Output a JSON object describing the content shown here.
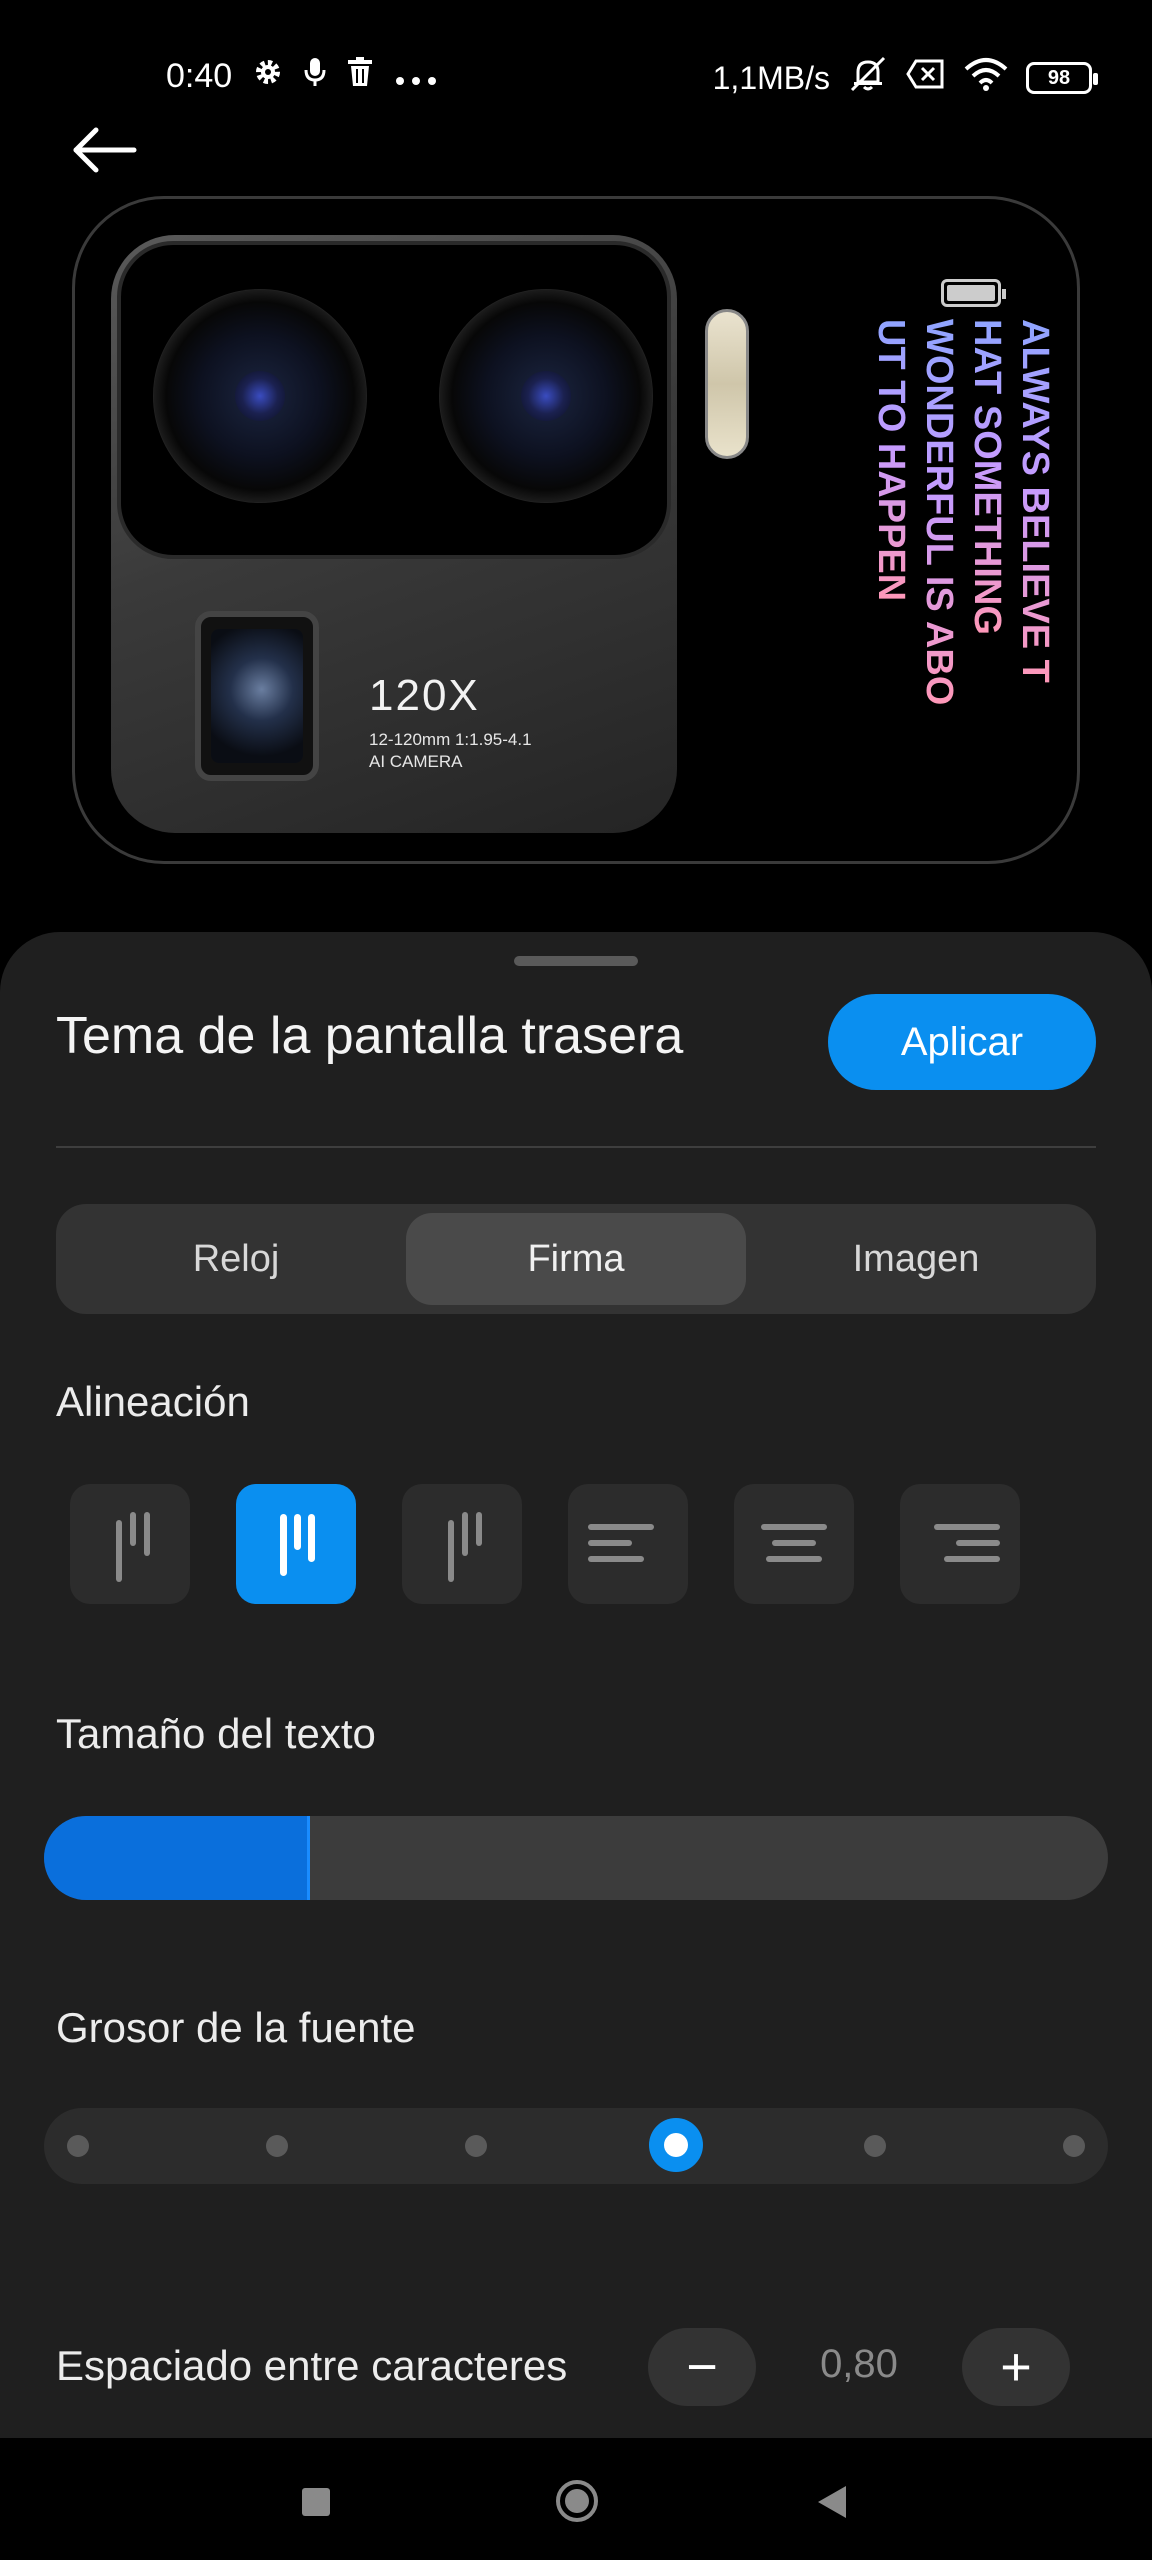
{
  "status_bar": {
    "time": "0:40",
    "net_speed": "1,1MB/s",
    "battery_level": "98",
    "left_icons": [
      "gear-icon",
      "mic-icon",
      "trash-icon",
      "more-dots-icon"
    ],
    "right_icons": [
      "mute-bell-icon",
      "data-off-icon",
      "wifi-icon",
      "battery-icon"
    ]
  },
  "header": {
    "back_icon": "back-arrow-icon"
  },
  "preview": {
    "zoom_label": "120X",
    "spec_line1": "12-120mm 1:1.95-4.1",
    "spec_line2": "AI CAMERA",
    "signature_lines": [
      "ALWAYS BELIEVE T",
      "HAT SOMETHING",
      "WONDERFUL IS ABO",
      "UT TO HAPPEN"
    ]
  },
  "sheet": {
    "title": "Tema de la pantalla trasera",
    "apply_label": "Aplicar",
    "tabs": [
      {
        "label": "Reloj",
        "active": false
      },
      {
        "label": "Firma",
        "active": true
      },
      {
        "label": "Imagen",
        "active": false
      }
    ],
    "alignment": {
      "label": "Alineación",
      "options": [
        "vertical-top-left",
        "vertical-top-center",
        "vertical-top-right",
        "horizontal-left",
        "horizontal-center",
        "horizontal-right"
      ],
      "selected_index": 1
    },
    "text_size": {
      "label": "Tamaño del texto",
      "value_fraction": 0.25
    },
    "font_weight": {
      "label": "Grosor de la fuente",
      "steps": 6,
      "selected_index": 3
    },
    "letter_spacing": {
      "label": "Espaciado entre caracteres",
      "value": "0,80",
      "minus": "−",
      "plus": "+"
    }
  },
  "colors": {
    "accent": "#0a8ff0",
    "sheet_bg": "#1f1f1f",
    "page_bg": "#000000"
  },
  "nav_bar": {
    "icons": [
      "recents-square-icon",
      "home-circle-icon",
      "back-triangle-icon"
    ]
  }
}
